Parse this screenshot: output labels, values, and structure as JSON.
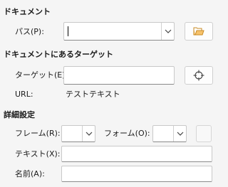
{
  "document": {
    "heading": "ドキュメント",
    "path_label": "パス(P):",
    "path_value": ""
  },
  "target_in_document": {
    "heading": "ドキュメントにあるターゲット",
    "target_label": "ターゲット(E):",
    "target_value": "",
    "url_label": "URL:",
    "url_value": "テストテキスト"
  },
  "further_settings": {
    "heading": "詳細設定",
    "frame_label": "フレーム(R):",
    "frame_value": "",
    "form_label": "フォーム(O):",
    "form_value": "",
    "text_label": "テキスト(X):",
    "text_value": "",
    "name_label": "名前(A):",
    "name_value": ""
  },
  "icons": {
    "open_file": "folder-open-icon",
    "target": "crosshair-target-icon",
    "dropdown": "chevron-down-icon"
  },
  "colors": {
    "background": "#f5f5f5",
    "field_bg": "#ffffff",
    "folder": "#e8a33d"
  }
}
